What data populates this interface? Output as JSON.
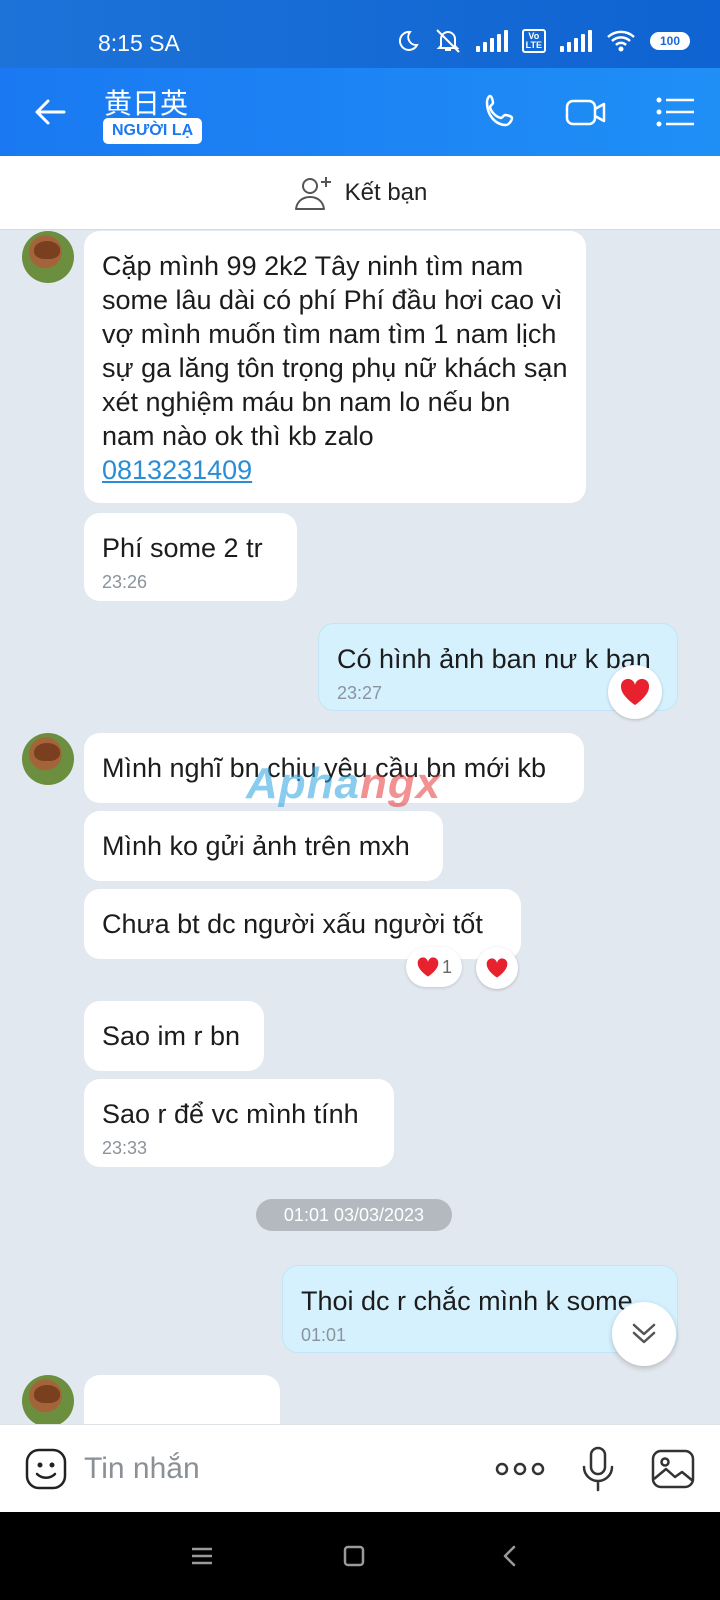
{
  "status_bar": {
    "time": "8:15 SA",
    "battery": "100",
    "volte": "Vo\nLTE"
  },
  "header": {
    "contact_name": "黄日英",
    "badge": "NGƯỜI LẠ"
  },
  "friend_bar": {
    "label": "Kết bạn"
  },
  "messages": [
    {
      "side": "them",
      "text": "Cặp mình 99 2k2 Tây ninh tìm nam some lâu dài có phí Phí đầu hơi cao vì vợ mình muốn tìm nam tìm 1 nam lịch sự ga lăng tôn trọng phụ nữ khách sạn xét nghiệm máu bn nam lo nếu bn nam nào ok thì kb zalo",
      "phone": "0813231409"
    },
    {
      "side": "them",
      "text": "Phí some 2 tr",
      "time": "23:26"
    },
    {
      "side": "me",
      "text": "Có hình ảnh ban nư k ban",
      "time": "23:27"
    },
    {
      "side": "them",
      "text": "Mình nghĩ bn chịu yêu cầu bn mới kb"
    },
    {
      "side": "them",
      "text": "Mình ko gửi ảnh trên mxh"
    },
    {
      "side": "them",
      "text": "Chưa bt dc người xấu người tốt",
      "reaction_count": "1"
    },
    {
      "side": "them",
      "text": "Sao im r bn"
    },
    {
      "side": "them",
      "text": "Sao r để vc mình tính",
      "time": "23:33"
    },
    {
      "side": "me",
      "text": "Thoi dc r chắc mình k some",
      "time": "01:01"
    }
  ],
  "date_separator": "01:01 03/03/2023",
  "watermark": {
    "part1": "Apha",
    "part2": "ngx"
  },
  "input": {
    "placeholder": "Tin nhắn"
  },
  "colors": {
    "header_blue": "#1a79f2",
    "my_bubble": "#d5f1fe",
    "chat_bg": "#e2e8ef",
    "link": "#2a8ed6",
    "heart": "#e8212f"
  },
  "icons": [
    "back-arrow-icon",
    "phone-icon",
    "video-icon",
    "list-menu-icon",
    "add-friend-icon",
    "heart-icon",
    "chevron-double-down-icon",
    "sticker-icon",
    "more-dots-icon",
    "microphone-icon",
    "image-icon"
  ]
}
